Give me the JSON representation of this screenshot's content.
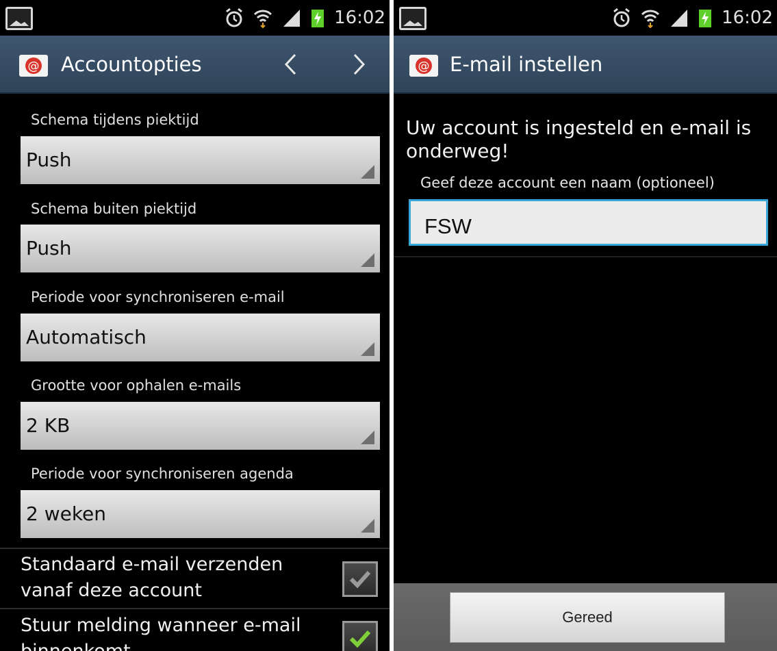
{
  "status_bar": {
    "time": "16:02"
  },
  "left": {
    "title": "Accountopties",
    "settings": [
      {
        "label": "Schema tijdens piektijd",
        "value": "Push"
      },
      {
        "label": "Schema buiten piektijd",
        "value": "Push"
      },
      {
        "label": "Periode voor synchroniseren e-mail",
        "value": "Automatisch"
      },
      {
        "label": "Grootte voor ophalen e-mails",
        "value": "2 KB"
      },
      {
        "label": "Periode voor synchroniseren agenda",
        "value": "2 weken"
      }
    ],
    "checkboxes": [
      {
        "label": "Standaard e-mail verzenden vanaf deze account",
        "checked": true,
        "enabled": false
      },
      {
        "label": "Stuur melding wanneer e-mail binnenkomt",
        "checked": true,
        "enabled": true
      }
    ]
  },
  "right": {
    "title": "E-mail instellen",
    "message": "Uw account is ingesteld en e-mail is onderweg!",
    "name_label": "Geef deze account een naam (optioneel)",
    "name_value": "FSW",
    "done_label": "Gereed"
  },
  "colors": {
    "title_bar": "#3a5068",
    "input_focus": "#3aa7d9",
    "check_active": "#7fcf3a",
    "check_disabled": "#9a9a9a"
  },
  "icons": [
    "gallery-icon",
    "alarm-icon",
    "wifi-icon",
    "signal-icon",
    "battery-charging-icon",
    "email-app-icon",
    "chevron-left-icon",
    "chevron-right-icon",
    "checkmark-icon"
  ]
}
